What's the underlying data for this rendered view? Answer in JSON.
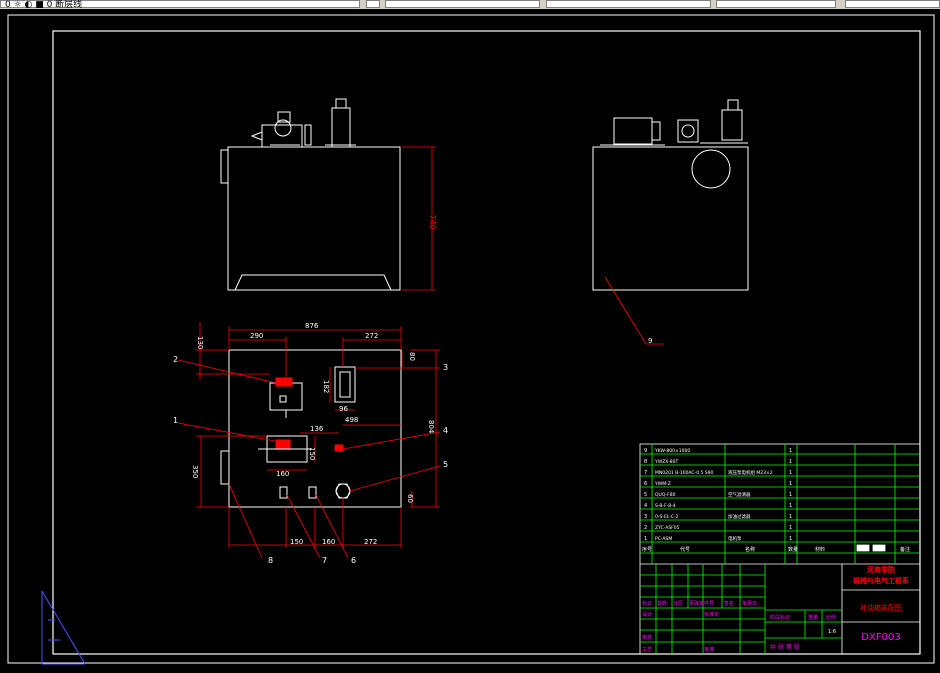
{
  "toolbar": {
    "layer_text": "0 ☼ ◐ ■ 0 断层线"
  },
  "drawing": {
    "front_view": {
      "height_dim": "740"
    },
    "top_view": {
      "dims": {
        "overall_width": "876",
        "left_offset": "290",
        "right_offset": "272",
        "dim_130": "130",
        "dim_182": "182",
        "dim_96": "96",
        "dim_80": "80",
        "dim_804": "804",
        "dim_136": "136",
        "dim_498": "498",
        "dim_150": "150",
        "dim_160": "160",
        "dim_350": "350",
        "dim_bot_150": "150",
        "dim_bot_160": "160",
        "dim_bot_272": "272",
        "dim_60": "60"
      },
      "balloons": [
        "1",
        "2",
        "3",
        "4",
        "5",
        "6",
        "7",
        "8"
      ]
    },
    "side_view": {
      "balloon": "9"
    }
  },
  "title_block": {
    "parts": [
      {
        "no": "9",
        "code": "YKW-800×1000",
        "name": ""
      },
      {
        "no": "8",
        "code": "YWZX-80T",
        "name": ""
      },
      {
        "no": "7",
        "code": "MN0201 B-100AC-0.5 S90",
        "name": "液压泵电机组 M23×2"
      },
      {
        "no": "6",
        "code": "YWM-Z",
        "name": ""
      },
      {
        "no": "5",
        "code": "QUQ-F80",
        "name": "空气滤清器"
      },
      {
        "no": "4",
        "code": "S-B-F-8-4",
        "name": ""
      },
      {
        "no": "3",
        "code": "0-S-EL-C-2",
        "name": "加油过滤器"
      },
      {
        "no": "2",
        "code": "ZYC-ASF05",
        "name": ""
      },
      {
        "no": "1",
        "code": "PC-ASM",
        "name": "电机泵"
      }
    ],
    "header_labels": [
      "序号",
      "代号",
      "名称",
      "数量",
      "材料",
      "备注"
    ],
    "school": "河南学院",
    "dept": "机械与电气工程系",
    "drawing_name": "补油箱装配图",
    "drawing_code": "DXF003",
    "rev_labels": [
      "标记",
      "处数",
      "分区",
      "更改文件号",
      "签名",
      "年月日"
    ],
    "role_labels": [
      "设计",
      "标准化",
      "审核",
      "工艺",
      "批准"
    ],
    "stage_labels": [
      "阶段标记",
      "重量",
      "比例"
    ],
    "scale": "1:6",
    "sheet": "共  张  第  张"
  },
  "colors": {
    "background": "#000000",
    "drawing": "#ffffff",
    "dimension": "#ff0000",
    "frame": "#00ff00",
    "text_magenta": "#ff00ff"
  }
}
